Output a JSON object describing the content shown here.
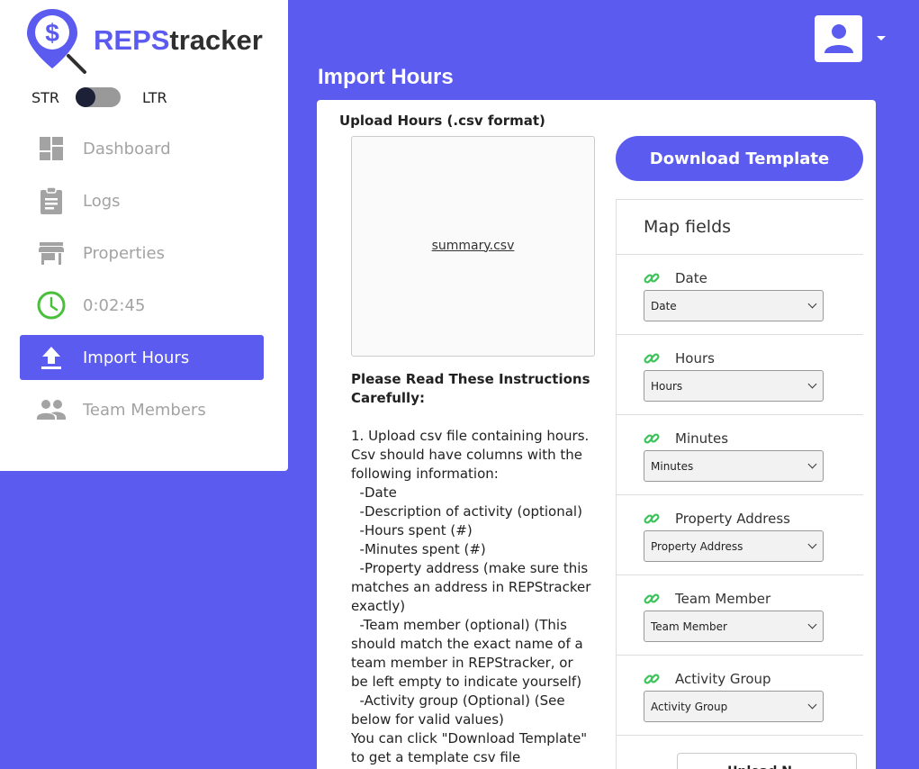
{
  "brand": {
    "name_part1": "REPS",
    "name_part2": "tracker",
    "accent": "#5b5bef"
  },
  "direction": {
    "left_label": "STR",
    "right_label": "LTR"
  },
  "nav": {
    "items": [
      {
        "label": "Dashboard",
        "icon": "dashboard-icon"
      },
      {
        "label": "Logs",
        "icon": "clipboard-icon"
      },
      {
        "label": "Properties",
        "icon": "store-icon"
      },
      {
        "label": "0:02:45",
        "icon": "clock-icon"
      },
      {
        "label": "Import Hours",
        "icon": "upload-icon",
        "active": true
      },
      {
        "label": "Team Members",
        "icon": "people-icon"
      }
    ]
  },
  "header": {
    "avatar_icon": "user-icon"
  },
  "page": {
    "title": "Import Hours"
  },
  "upload": {
    "title": "Upload Hours (.csv format)",
    "file_name": "summary.csv"
  },
  "instructions": {
    "title": "Please Read These Instructions Carefully:",
    "lines": [
      "1. Upload csv file containing hours. Csv should have columns with the following information:",
      "  -Date",
      "  -Description of activity (optional)",
      "  -Hours spent (#)",
      "  -Minutes spent (#)",
      "  -Property address (make sure this matches an address in REPStracker exactly)",
      "  -Team member (optional) (This should match the exact name of a team member in REPStracker, or be left empty to indicate yourself)",
      "  -Activity group (Optional) (See below for valid values)",
      "You can click \"Download Template\" to get a template csv file"
    ]
  },
  "download_template_label": "Download Template",
  "map_fields": {
    "title": "Map fields",
    "fields": [
      {
        "label": "Date",
        "selected": "Date"
      },
      {
        "label": "Hours",
        "selected": "Hours"
      },
      {
        "label": "Minutes",
        "selected": "Minutes"
      },
      {
        "label": "Property Address",
        "selected": "Property Address"
      },
      {
        "label": "Team Member",
        "selected": "Team Member"
      },
      {
        "label": "Activity Group",
        "selected": "Activity Group"
      }
    ],
    "link_color": "#3cc35a"
  },
  "upload_button_label": "Upload N..."
}
